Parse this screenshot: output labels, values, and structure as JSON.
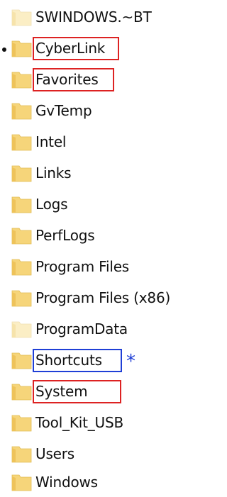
{
  "folders": [
    {
      "label": "SWINDOWS.~BT",
      "icon": "folder-icon",
      "style": "faded"
    },
    {
      "label": "CyberLink",
      "icon": "folder-icon",
      "highlight": "red",
      "marker": "bullet-dot"
    },
    {
      "label": "Favorites",
      "icon": "folder-icon",
      "highlight": "red"
    },
    {
      "label": "GvTemp",
      "icon": "folder-icon"
    },
    {
      "label": "Intel",
      "icon": "folder-icon"
    },
    {
      "label": "Links",
      "icon": "folder-icon"
    },
    {
      "label": "Logs",
      "icon": "folder-icon"
    },
    {
      "label": "PerfLogs",
      "icon": "folder-icon"
    },
    {
      "label": "Program Files",
      "icon": "folder-icon"
    },
    {
      "label": "Program Files (x86)",
      "icon": "folder-icon"
    },
    {
      "label": "ProgramData",
      "icon": "folder-icon",
      "style": "faded"
    },
    {
      "label": "Shortcuts",
      "icon": "folder-icon",
      "highlight": "blue",
      "marker": "star-icon"
    },
    {
      "label": "System",
      "icon": "folder-icon",
      "highlight": "red"
    },
    {
      "label": "Tool_Kit_USB",
      "icon": "folder-icon"
    },
    {
      "label": "Users",
      "icon": "folder-icon"
    },
    {
      "label": "Windows",
      "icon": "folder-icon"
    }
  ],
  "star_glyph": "*",
  "colors": {
    "folder_fill": "#f6d57a",
    "folder_tab": "#eec35a",
    "folder_faded_fill": "#fbeec5",
    "folder_faded_tab": "#f6e3ab",
    "highlight_red": "#dd2222",
    "highlight_blue": "#1f3fd6"
  }
}
